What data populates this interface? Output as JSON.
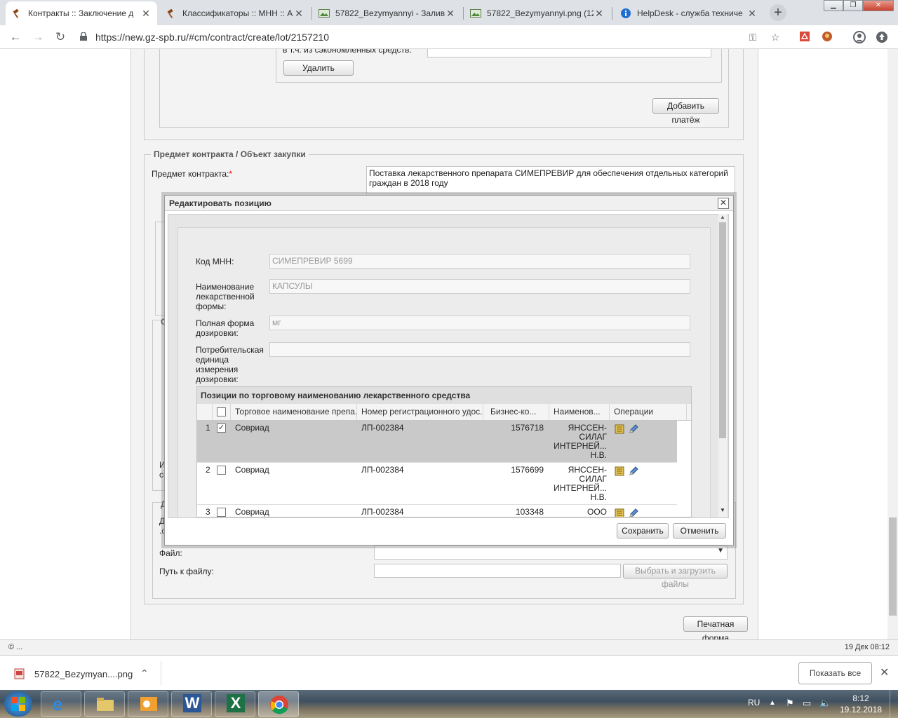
{
  "browser": {
    "tabs": [
      {
        "label": "Контракты :: Заключение д",
        "icon": "gavel-icon",
        "active": true
      },
      {
        "label": "Классификаторы :: МНН :: А",
        "icon": "gavel-icon",
        "active": false
      },
      {
        "label": "57822_Bezymyannyi - Залив",
        "icon": "image-icon",
        "active": false
      },
      {
        "label": "57822_Bezymyannyi.png (12",
        "icon": "image-icon",
        "active": false
      },
      {
        "label": "HelpDesk - служба техниче",
        "icon": "info-icon",
        "active": false
      }
    ],
    "close_glyph": "✕",
    "new_tab_glyph": "+",
    "url": "https://new.gz-spb.ru/#cm/contract/create/lot/2157210"
  },
  "page": {
    "economy_label": "в т.ч. из сэкономленных средств:",
    "delete_button": "Удалить",
    "add_payment_button": "Добавить платёж",
    "section_subject_legend": "Предмет контракта / Объект закупки",
    "subject_label": "Предмет контракта:",
    "required_mark": "*",
    "subject_value": "Поставка лекарственного препарата  СИМЕПРЕВИР  для обеспечения отдельных категорий граждан в 2018 году",
    "bg_fragments": [
      "С",
      "И",
      "сг",
      "Д",
      "Д",
      ".с"
    ],
    "file_label": "Файл:",
    "file_path_label": "Путь к файлу:",
    "upload_button": "Выбрать и загрузить файлы",
    "print_form_button": "Печатная форма"
  },
  "modal": {
    "title": "Редактировать позицию",
    "fields": [
      {
        "label": "Код МНН:",
        "value": ""
      },
      {
        "label": "Наименование лекарственной формы:",
        "value": ""
      },
      {
        "label": "Полная форма дозировки:",
        "value": ""
      },
      {
        "label": "Потребительская единица измерения дозировки:",
        "value": ""
      }
    ],
    "placeholders": [
      "СИМЕПРЕВИР 5699",
      "КАПСУЛЫ",
      "мг",
      ""
    ],
    "label_lines": [
      [
        "Код МНН:"
      ],
      [
        "Наименование",
        "лекарственной",
        "формы:"
      ],
      [
        "Полная форма",
        "дозировки:"
      ],
      [
        "Потребительская",
        "единица",
        "измерения",
        "дозировки:"
      ]
    ],
    "grid": {
      "title": "Позиции по торговому наименованию лекарственного средства",
      "columns": [
        "Торговое наименование препа...",
        "Номер регистрационного удос...",
        "Бизнес-ко...",
        "Наименов...",
        "Операции"
      ],
      "rows": [
        {
          "num": "1",
          "checked": true,
          "trade_name": "Совриад",
          "reg_number": "ЛП-002384",
          "business_code": "1576718",
          "maker_lines": [
            "ЯНССЕН-",
            "СИЛАГ",
            "ИНТЕРНЕЙ...",
            "Н.В."
          ]
        },
        {
          "num": "2",
          "checked": false,
          "trade_name": "Совриад",
          "reg_number": "ЛП-002384",
          "business_code": "1576699",
          "maker_lines": [
            "ЯНССЕН-",
            "СИЛАГ",
            "ИНТЕРНЕЙ...",
            "Н.В."
          ]
        },
        {
          "num": "3",
          "checked": false,
          "trade_name": "Совриад",
          "reg_number": "ЛП-002384",
          "business_code": "103348",
          "maker_lines": [
            "ООО"
          ]
        }
      ]
    },
    "save_button": "Сохранить",
    "cancel_button": "Отменить"
  },
  "status_bar": {
    "left": "© ...",
    "right": "19 Дек 08:12"
  },
  "downloads": {
    "file": "57822_Bezymyan....png",
    "show_all": "Показать все"
  },
  "taskbar": {
    "lang": "RU",
    "time": "8:12",
    "date": "19.12.2018"
  },
  "colors": {
    "modal_header": "#f0f0f0",
    "selected_row": "#c9c9c9",
    "page_bg": "#f3f3f3",
    "accent_link": "#1a73e8"
  }
}
